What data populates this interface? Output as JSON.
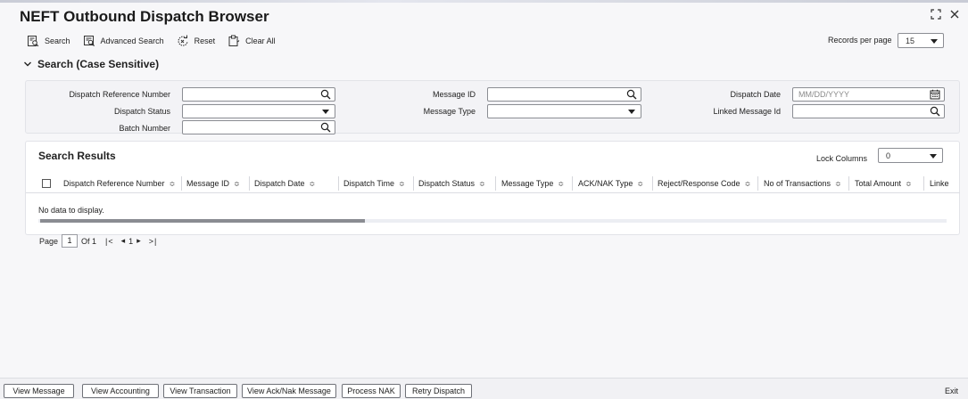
{
  "page": {
    "title": "NEFT Outbound Dispatch Browser"
  },
  "toolbar": {
    "search": "Search",
    "advanced_search": "Advanced Search",
    "reset": "Reset",
    "clear_all": "Clear All",
    "records_per_page_label": "Records per page",
    "records_per_page_value": "15"
  },
  "search": {
    "title": "Search (Case Sensitive)",
    "dispatch_reference_number": "Dispatch Reference Number",
    "message_id": "Message ID",
    "dispatch_date": "Dispatch Date",
    "dispatch_date_placeholder": "MM/DD/YYYY",
    "dispatch_status": "Dispatch Status",
    "message_type": "Message Type",
    "linked_message_id": "Linked Message Id",
    "batch_number": "Batch Number"
  },
  "results": {
    "title": "Search Results",
    "lock_columns_label": "Lock Columns",
    "lock_columns_value": "0",
    "columns": [
      "Dispatch Reference Number",
      "Message ID",
      "Dispatch Date",
      "Dispatch Time",
      "Dispatch Status",
      "Message Type",
      "ACK/NAK Type",
      "Reject/Response Code",
      "No of Transactions",
      "Total Amount",
      "Linke"
    ],
    "sort_glyph": "≎",
    "no_data": "No data to display."
  },
  "pagination": {
    "page_label": "Page",
    "current_page": "1",
    "of_label": "Of 1",
    "first": "|<",
    "prev": "◂",
    "page_num": "1",
    "next": "▸",
    "last": ">|"
  },
  "footer": {
    "buttons": [
      "View Message",
      "View Accounting",
      "View Transaction",
      "View Ack/Nak Message",
      "Process NAK",
      "Retry Dispatch"
    ],
    "exit": "Exit"
  }
}
